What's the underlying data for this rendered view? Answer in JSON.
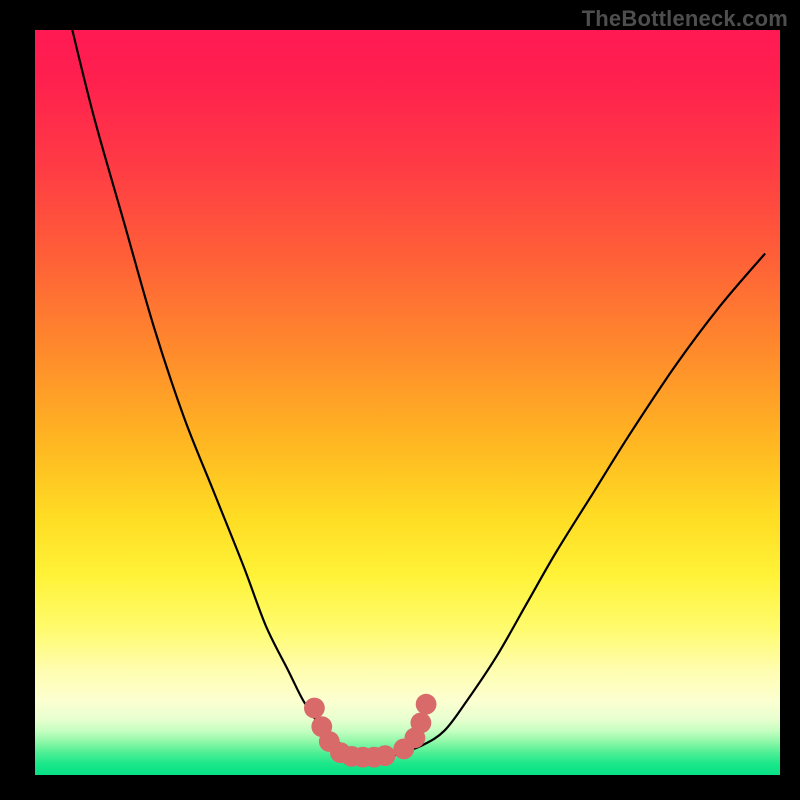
{
  "watermark": "TheBottleneck.com",
  "colors": {
    "frame": "#000000",
    "curve": "#000000",
    "marker_fill": "#d86a6a",
    "marker_stroke": "#c55",
    "gradient_top": "#ff1a53",
    "gradient_bottom": "#07e085"
  },
  "chart_data": {
    "type": "line",
    "title": "",
    "xlabel": "",
    "ylabel": "",
    "xlim": [
      0,
      100
    ],
    "ylim": [
      0,
      100
    ],
    "note": "No axis labels, tick labels, or numeric data labels are rendered in the image; x/y values below are visual estimates of the black V-shaped curve (y = percent distance from top of plot area; 0 = top, 100 = bottom).",
    "series": [
      {
        "name": "bottleneck-curve",
        "x": [
          5,
          8,
          12,
          16,
          20,
          24,
          28,
          31,
          34,
          36,
          38,
          40,
          42,
          44,
          46,
          48,
          52,
          55,
          58,
          62,
          66,
          70,
          75,
          80,
          86,
          92,
          98
        ],
        "y": [
          0,
          12,
          26,
          40,
          52,
          62,
          72,
          80,
          86,
          90,
          93,
          95,
          96.5,
          97.2,
          97.5,
          97.4,
          96,
          94,
          90,
          84,
          77,
          70,
          62,
          54,
          45,
          37,
          30
        ]
      }
    ],
    "markers": {
      "name": "highlight-dots",
      "note": "Salmon-colored circular markers clustered around the valley floor of the curve.",
      "points": [
        {
          "x": 37.5,
          "y": 91
        },
        {
          "x": 38.5,
          "y": 93.5
        },
        {
          "x": 39.5,
          "y": 95.5
        },
        {
          "x": 41,
          "y": 97
        },
        {
          "x": 42.5,
          "y": 97.5
        },
        {
          "x": 44,
          "y": 97.6
        },
        {
          "x": 45.5,
          "y": 97.6
        },
        {
          "x": 47,
          "y": 97.4
        },
        {
          "x": 49.5,
          "y": 96.5
        },
        {
          "x": 51,
          "y": 95
        },
        {
          "x": 51.8,
          "y": 93
        },
        {
          "x": 52.5,
          "y": 90.5
        }
      ],
      "radius_pct": 1.4
    }
  }
}
